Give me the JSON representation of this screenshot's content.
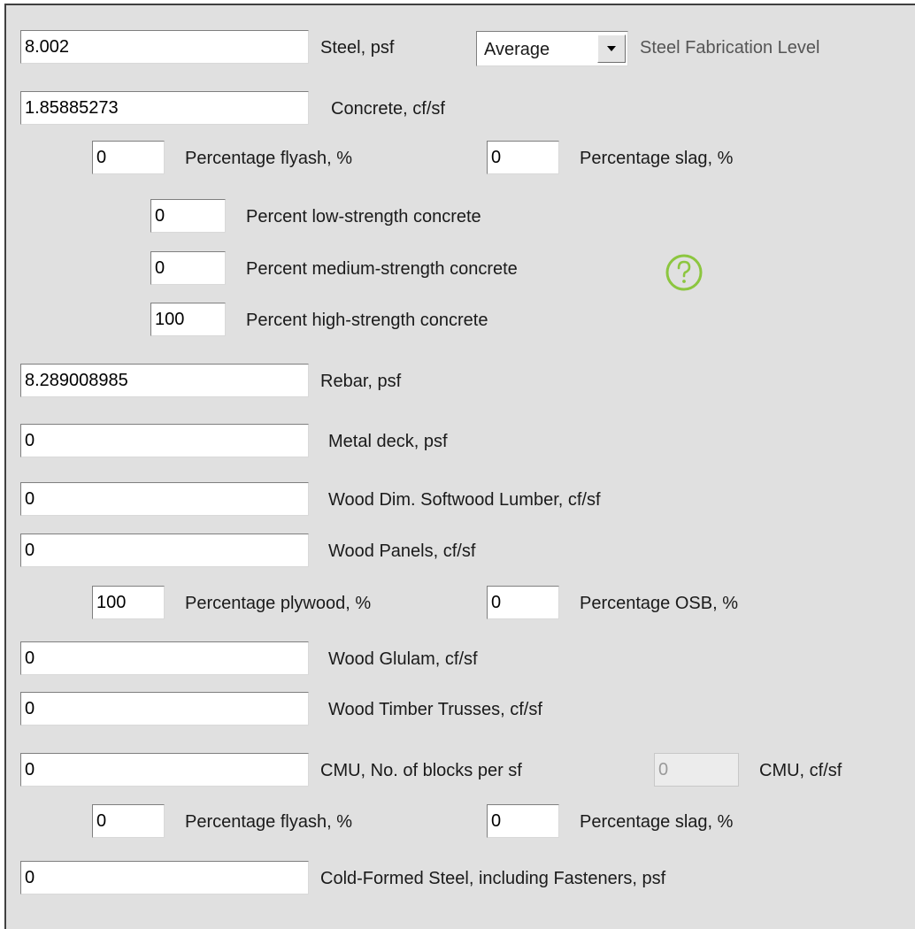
{
  "steel": {
    "value": "8.002",
    "label": "Steel, psf",
    "fabrication_selected": "Average",
    "fabrication_label": "Steel Fabrication Level"
  },
  "concrete": {
    "value": "1.85885273",
    "label": "Concrete, cf/sf",
    "flyash_value": "0",
    "flyash_label": "Percentage flyash, %",
    "slag_value": "0",
    "slag_label": "Percentage slag, %",
    "low_value": "0",
    "low_label": "Percent low-strength concrete",
    "medium_value": "0",
    "medium_label": "Percent medium-strength concrete",
    "high_value": "100",
    "high_label": "Percent high-strength concrete"
  },
  "rebar": {
    "value": "8.289008985",
    "label": "Rebar, psf"
  },
  "metal_deck": {
    "value": "0",
    "label": "Metal deck, psf"
  },
  "wood_dim": {
    "value": "0",
    "label": "Wood Dim. Softwood Lumber, cf/sf"
  },
  "wood_panels": {
    "value": "0",
    "label": "Wood Panels, cf/sf",
    "plywood_value": "100",
    "plywood_label": "Percentage plywood, %",
    "osb_value": "0",
    "osb_label": "Percentage OSB, %"
  },
  "glulam": {
    "value": "0",
    "label": "Wood Glulam, cf/sf"
  },
  "trusses": {
    "value": "0",
    "label": "Wood Timber Trusses, cf/sf"
  },
  "cmu": {
    "value": "0",
    "label": "CMU, No. of blocks per sf",
    "cf_value": "0",
    "cf_label": "CMU, cf/sf",
    "flyash_value": "0",
    "flyash_label": "Percentage flyash, %",
    "slag_value": "0",
    "slag_label": "Percentage slag, %"
  },
  "cold_formed": {
    "value": "0",
    "label": "Cold-Formed Steel, including Fasteners, psf"
  },
  "icons": {
    "help": "help-question-icon",
    "dropdown": "dropdown-arrow-icon"
  },
  "colors": {
    "panel": "#e0e0e0",
    "help_icon": "#8cc63f"
  }
}
